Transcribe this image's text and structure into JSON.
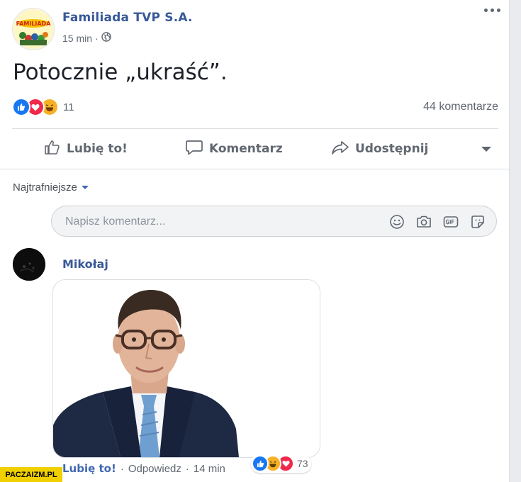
{
  "post": {
    "page_name": "Familiada TVP S.A.",
    "time": "15 min",
    "separator": "·",
    "audience_icon": "globe-icon",
    "text": "Potocznie „ukraść”.",
    "reactions": {
      "icons": [
        "like-icon",
        "love-icon",
        "haha-icon"
      ],
      "count": "11"
    },
    "comments_count": "44 komentarze",
    "logo_text": "FAMILIADA"
  },
  "actions": {
    "like": "Lubię to!",
    "comment": "Komentarz",
    "share": "Udostępnij"
  },
  "comments": {
    "sort_label": "Najtrafniejsze",
    "input_placeholder": "Napisz komentarz...",
    "input_icons": [
      "emoji-icon",
      "camera-icon",
      "gif-icon",
      "sticker-icon"
    ],
    "items": [
      {
        "author": "Mikołaj",
        "like_label": "Lubię to!",
        "reply_label": "Odpowiedz",
        "sep": "·",
        "time": "14 min",
        "reactions": {
          "icons": [
            "like-icon",
            "haha-icon",
            "love-icon"
          ],
          "count": "73"
        }
      }
    ]
  },
  "watermark": "PACZAIZM.PL",
  "colors": {
    "link_blue": "#385898",
    "like_blue": "#4267b2",
    "love_red": "#f0284a",
    "haha_yellow": "#f7b125",
    "secondary_text": "#606770"
  }
}
